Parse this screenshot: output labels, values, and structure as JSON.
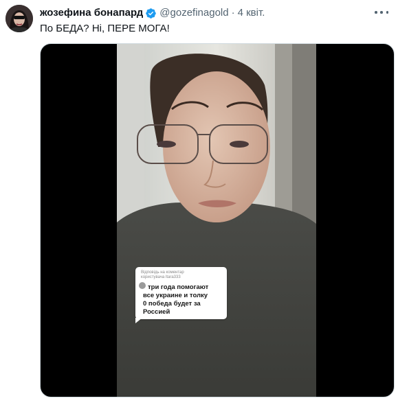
{
  "tweet": {
    "display_name": "жозефина бонапард",
    "handle": "@gozefinagold",
    "separator": "·",
    "time": "4 квіт.",
    "text": "По БЕДА? Ні, ПЕРЕ МОГА!",
    "verified_icon": "verified-badge-icon",
    "more_icon": "more-options-icon"
  },
  "video": {
    "comment_reply_line1": "Відповідь на коментар",
    "comment_reply_line2": "користувача ltara333",
    "comment_line1": "три года помогают",
    "comment_line2": "все украине и толку",
    "comment_line3": "0 победа будет за",
    "comment_line4": "Россией"
  },
  "colors": {
    "accent": "#1d9bf0",
    "text_primary": "#0f1419",
    "text_secondary": "#536471",
    "media_bg": "#000000"
  }
}
